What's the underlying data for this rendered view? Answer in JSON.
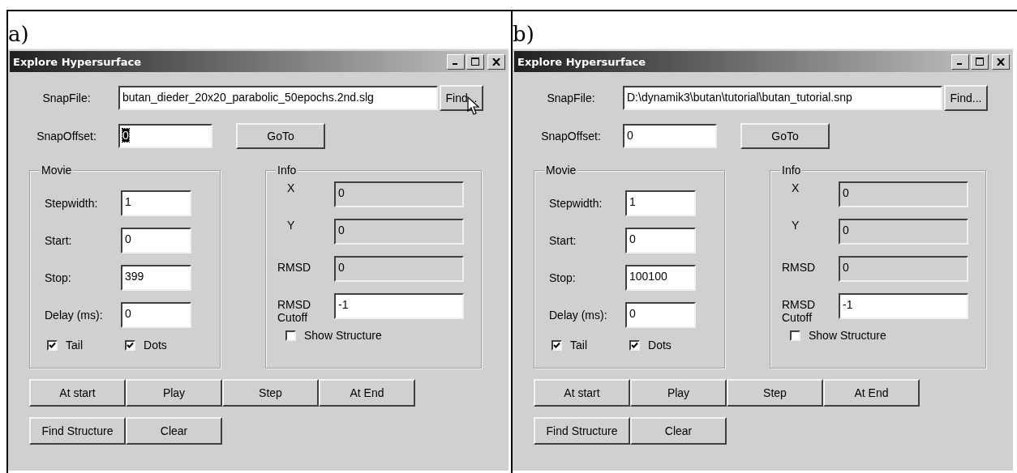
{
  "panels": [
    {
      "label": "a)",
      "window": {
        "title": "Explore Hypersurface"
      },
      "snap_file": {
        "label": "SnapFile:",
        "value": "butan_dieder_20x20_parabolic_50epochs.2nd.slg",
        "button": "Find...",
        "pointer_hover": true
      },
      "snap_offset": {
        "label": "SnapOffset:",
        "value": "0",
        "selected": true,
        "button": "GoTo"
      },
      "movie": {
        "title": "Movie",
        "fields": [
          {
            "label": "Stepwidth:",
            "value": "1"
          },
          {
            "label": "Start:",
            "value": "0"
          },
          {
            "label": "Stop:",
            "value": "399"
          },
          {
            "label": "Delay (ms):",
            "value": "0"
          }
        ],
        "checkboxes": [
          {
            "label": "Tail",
            "checked": true
          },
          {
            "label": "Dots",
            "checked": true
          }
        ]
      },
      "info": {
        "title": "Info",
        "fields": [
          {
            "label": "X",
            "value": "0",
            "disabled": true
          },
          {
            "label": "Y",
            "value": "0",
            "disabled": true
          },
          {
            "label": "RMSD",
            "value": "0",
            "disabled": true
          },
          {
            "label": "RMSD Cutoff",
            "value": "-1",
            "disabled": false
          }
        ],
        "checkboxes": [
          {
            "label": "Show Structure",
            "checked": false
          }
        ]
      },
      "button_rows": [
        {
          "buttons": [
            "At start",
            "Play",
            "Step",
            "At End"
          ]
        },
        {
          "buttons": [
            "Find Structure",
            "Clear"
          ]
        }
      ]
    },
    {
      "label": "b)",
      "window": {
        "title": "Explore Hypersurface"
      },
      "snap_file": {
        "label": "SnapFile:",
        "value": "D:\\dynamik3\\butan\\tutorial\\butan_tutorial.snp",
        "button": "Find...",
        "pointer_hover": false
      },
      "snap_offset": {
        "label": "SnapOffset:",
        "value": "0",
        "selected": false,
        "button": "GoTo"
      },
      "movie": {
        "title": "Movie",
        "fields": [
          {
            "label": "Stepwidth:",
            "value": "1"
          },
          {
            "label": "Start:",
            "value": "0"
          },
          {
            "label": "Stop:",
            "value": "100100"
          },
          {
            "label": "Delay (ms):",
            "value": "0"
          }
        ],
        "checkboxes": [
          {
            "label": "Tail",
            "checked": true
          },
          {
            "label": "Dots",
            "checked": true
          }
        ]
      },
      "info": {
        "title": "Info",
        "fields": [
          {
            "label": "X",
            "value": "0",
            "disabled": true
          },
          {
            "label": "Y",
            "value": "0",
            "disabled": true
          },
          {
            "label": "RMSD",
            "value": "0",
            "disabled": true
          },
          {
            "label": "RMSD Cutoff",
            "value": "-1",
            "disabled": false
          }
        ],
        "checkboxes": [
          {
            "label": "Show Structure",
            "checked": false
          }
        ]
      },
      "button_rows": [
        {
          "buttons": [
            "At start",
            "Play",
            "Step",
            "At End"
          ]
        },
        {
          "buttons": [
            "Find Structure",
            "Clear"
          ]
        }
      ]
    }
  ]
}
